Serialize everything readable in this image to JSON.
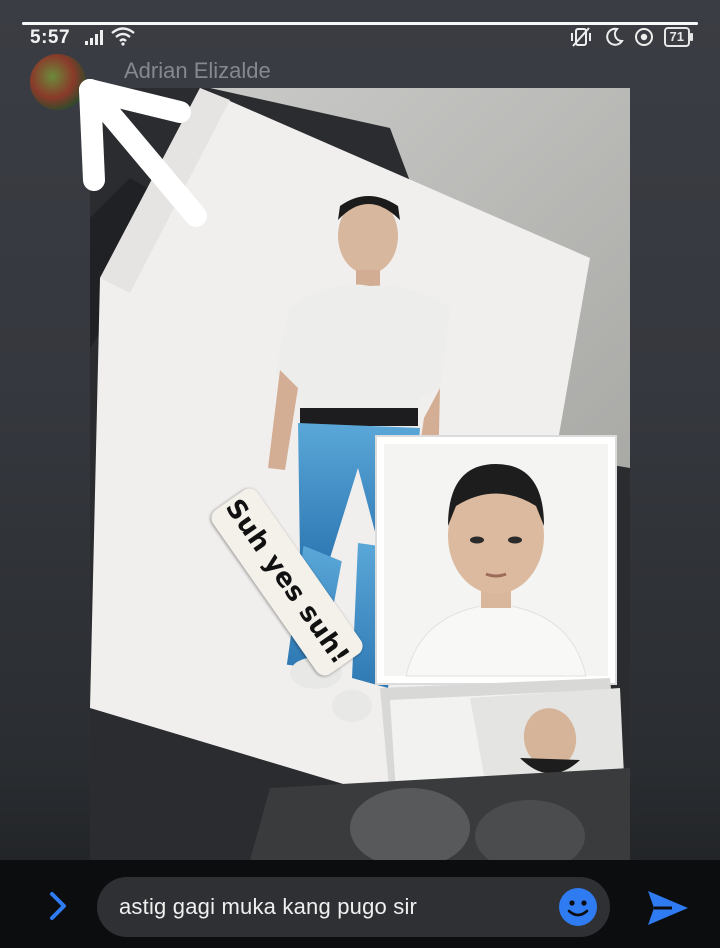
{
  "status_bar": {
    "time": "5:57",
    "signal_icon": "signal-bars-icon",
    "wifi_icon": "wifi-icon",
    "right_icons": [
      "vibrate-icon",
      "moon-icon",
      "data-saver-icon"
    ],
    "battery": "71"
  },
  "story": {
    "progress": 1.0,
    "user_name": "Adrian Elizalde",
    "avatar_icon": "avatar",
    "sticker_text": "Suh yes suh!"
  },
  "reply": {
    "expand_icon": "chevron-right-icon",
    "text": "astig gagi muka kang pugo sir",
    "emoji_icon": "smiley-icon",
    "send_icon": "send-icon"
  },
  "colors": {
    "accent": "#2f7bf2",
    "bottom_bar": "#0c0d0f",
    "pill": "#2e3034"
  }
}
